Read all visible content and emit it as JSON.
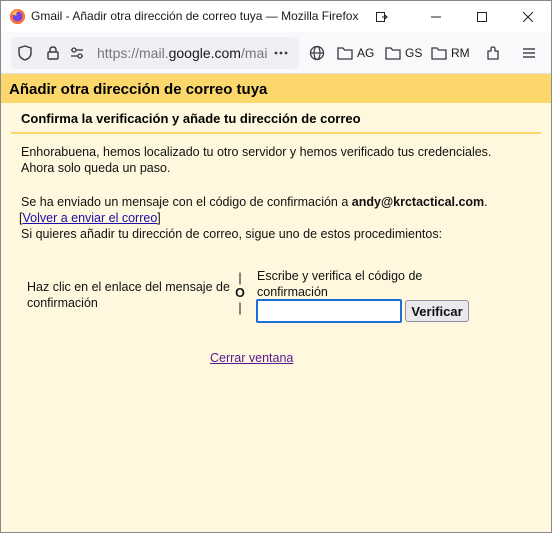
{
  "window": {
    "title": "Gmail - Añadir otra dirección de correo tuya — Mozilla Firefox"
  },
  "navbar": {
    "url_prefix": "https://mail.",
    "url_domain": "google.com",
    "url_suffix": "/mai",
    "bookmarks": [
      {
        "label": "AG",
        "icon": "folder-icon"
      },
      {
        "label": "GS",
        "icon": "folder-icon"
      },
      {
        "label": "RM",
        "icon": "folder-icon"
      }
    ]
  },
  "page": {
    "header": "Añadir otra dirección de correo tuya",
    "subheader": "Confirma la verificación y añade tu dirección de correo",
    "congrats_line1": "Enhorabuena, hemos localizado tu otro servidor y hemos verificado tus credenciales.",
    "congrats_line2": "Ahora solo queda un paso.",
    "sent_text": "Se ha enviado un mensaje con el código de confirmación a ",
    "email": "andy@krctactical.com",
    "sent_period": ".",
    "resend_open": "[",
    "resend_link": "Volver a enviar el correo",
    "resend_close": "]",
    "options_intro": "Si quieres añadir tu dirección de correo, sigue uno de estos procedimientos:",
    "option_left": "Haz clic en el enlace del mensaje de confirmación",
    "divider_top": "|",
    "divider_mid": "O",
    "divider_bottom": "|",
    "option_right": "Escribe y verifica el código de confirmación",
    "code_value": "",
    "verify_label": "Verificar",
    "close_link": "Cerrar ventana"
  },
  "colors": {
    "header_bg": "#fbd76c",
    "content_bg": "#fff8de",
    "input_focus": "#1c6fd6"
  }
}
